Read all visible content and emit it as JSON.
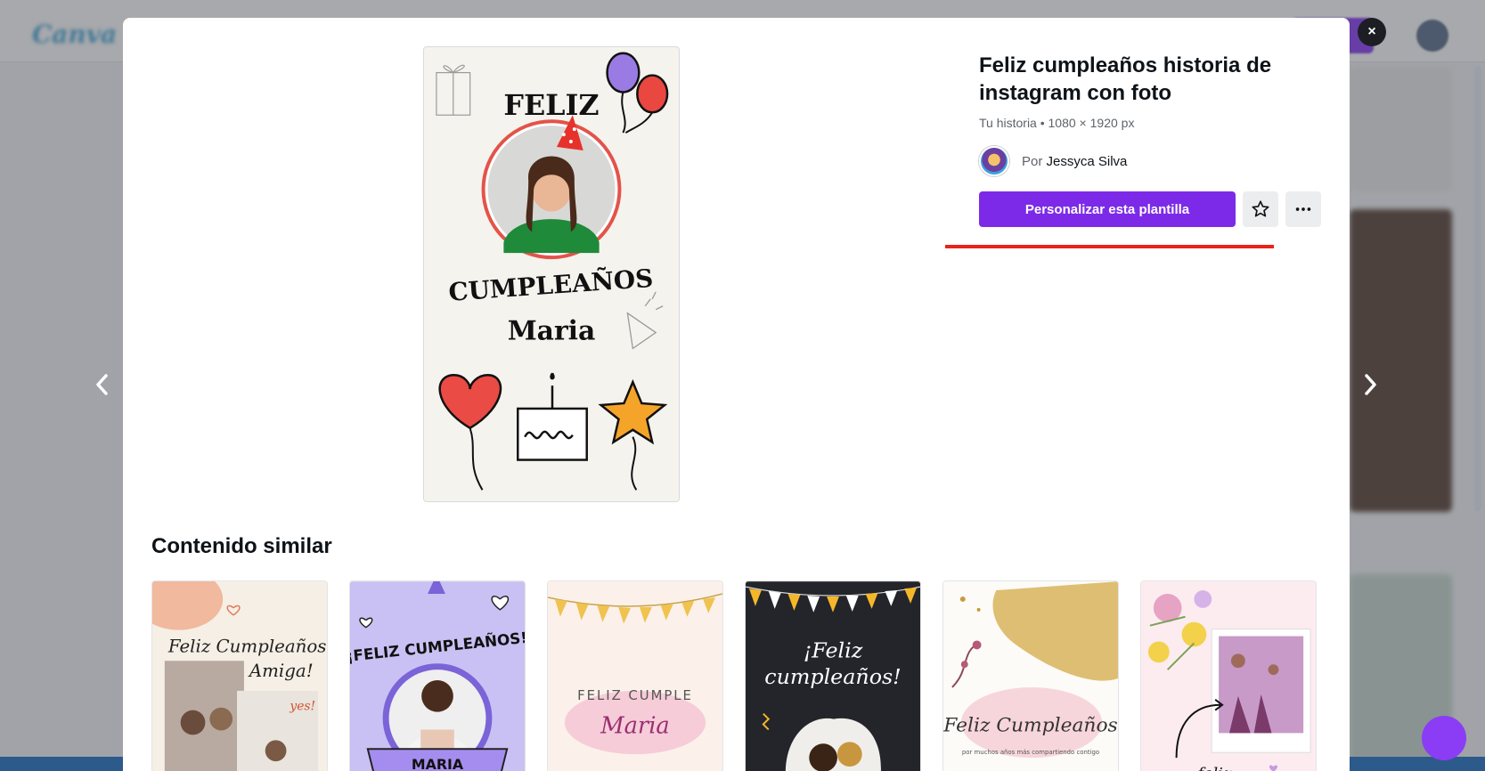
{
  "background": {
    "logo_text": "Canva"
  },
  "modal": {
    "close_label": "×",
    "prev_label": "‹",
    "next_label": "›"
  },
  "template": {
    "title": "Feliz cumpleaños historia de instagram con foto",
    "meta": "Tu historia • 1080 × 1920 px",
    "author_prefix": "Por",
    "author_name": "Jessyca Silva",
    "customize_label": "Personalizar esta plantilla",
    "favorite_icon": "star-icon",
    "more_icon": "more-icon",
    "more_label": "···",
    "favorite_label": "☆"
  },
  "preview": {
    "line1": "FELIZ",
    "line2": "CUMPLEAÑOS",
    "name": "Maria"
  },
  "similar": {
    "heading": "Contenido similar",
    "items": [
      {
        "text1": "Feliz Cumpleaños",
        "text2": "Amiga!",
        "text3": "yes!"
      },
      {
        "text1": "¡FELIZ CUMPLEAÑOS!",
        "text2": "MARIA"
      },
      {
        "text1": "FELIZ CUMPLE",
        "text2": "Maria"
      },
      {
        "text1": "¡Feliz",
        "text2": "cumpleaños!"
      },
      {
        "text1": "Feliz Cumpleaños",
        "text2": "por muchos años más compartiendo contigo"
      },
      {
        "text1": "feliz"
      }
    ]
  },
  "colors": {
    "accent": "#7d2ae8",
    "underline": "#e8241c"
  }
}
